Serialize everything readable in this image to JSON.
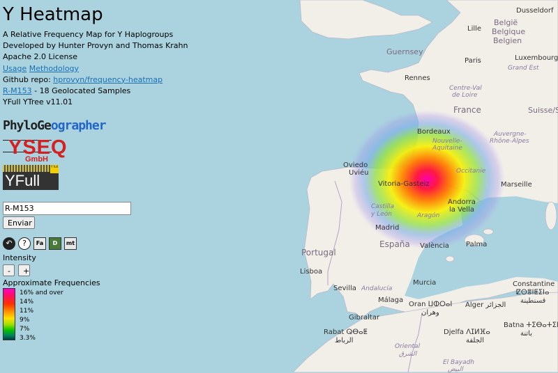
{
  "header": {
    "title": "Y Heatmap",
    "subtitle": "A Relative Frequency Map for Y Haplogroups",
    "developers": "Developed by Hunter Provyn and Thomas Krahn",
    "license": "Apache 2.0 License",
    "usage_link": "Usage",
    "methodology_link": "Methodology",
    "repo_prefix": "Github repo: ",
    "repo_link": "hprovyn/frequency-heatmap",
    "haplogroup_link": "R-M153",
    "samples_text": " - 18 Geolocated Samples",
    "tree_version": "YFull YTree v11.01"
  },
  "logos": {
    "phylo_part1": "PhyloGe",
    "phylo_part2": "o",
    "phylo_part3": "grapher",
    "yseq_main": "YSEQ",
    "yseq_sub": "GmbH",
    "yfull_text": "YFull",
    "yfull_badge": "Y full"
  },
  "search": {
    "value": "R-M153",
    "submit_label": "Enviar"
  },
  "tool_icons": [
    {
      "name": "back-icon",
      "glyph": "↶"
    },
    {
      "name": "help-icon",
      "glyph": "?"
    },
    {
      "name": "fa-icon",
      "glyph": "Fa"
    },
    {
      "name": "d-icon",
      "glyph": "D"
    },
    {
      "name": "mt-icon",
      "glyph": "mt"
    }
  ],
  "intensity": {
    "label": "Intensity",
    "decrease_label": "-",
    "increase_label": "+"
  },
  "legend": {
    "title": "Approximate Frequencies",
    "labels": [
      "16% and over",
      "14%",
      "11%",
      "9%",
      "7%",
      "3.3%"
    ],
    "colors": [
      "#ff00c8",
      "#ff1060",
      "#ff3000",
      "#ff9000",
      "#ffe000",
      "#00c000",
      "#004040"
    ]
  },
  "map": {
    "water_color": "#aad3df",
    "land_color": "#f2efe9",
    "labels": {
      "duesseldorf": "Dusseldorf",
      "lille": "Lille",
      "belgie": "België",
      "belgique": "Belgique",
      "belgien": "Belgien",
      "guernsey": "Guernsey",
      "luxembourg": "Luxembourg",
      "paris": "Paris",
      "grand_est": "Grand Est",
      "rennes": "Rennes",
      "centre_val1": "Centre-Val",
      "centre_val2": "de Loire",
      "france": "France",
      "suisse": "Suisse/S",
      "bordeaux": "Bordeaux",
      "nouvelle1": "Nouvelle-",
      "nouvelle2": "Aquitaine",
      "auvergne1": "Auvergne-",
      "auvergne2": "Rhône-Alpes",
      "oviedo": "Oviedo",
      "uvieu": "Uviéu",
      "vitoria": "Vitoria-Gasteiz",
      "occitanie": "Occitanie",
      "marseille": "Marseille",
      "andorra1": "Andorra",
      "andorra2": "la Vella",
      "castilla1": "Castilla",
      "castilla2": "y León",
      "madrid": "Madrid",
      "aragon": "Aragón",
      "espana": "España",
      "valencia": "València",
      "palma": "Palma",
      "portugal": "Portugal",
      "lisboa": "Lisboa",
      "sevilla": "Sevilla",
      "andalucia": "Andalucía",
      "murcia": "Murcia",
      "malaga": "Málaga",
      "gibraltar": "Gibraltar",
      "oran": "Oran ⵡⵀⵔⴰⵏ",
      "oran_ar": "وهران",
      "alger": "Alger الجزائر",
      "constantine": "Constantine",
      "constantine_tif": "ⵇⵙⴻⵏⵟⵉⵏⴰ",
      "constantine_ar": "قسنطينة",
      "rabat": "Rabat ⵕⴱⴰⵟ",
      "rabat_ar": "الرباط",
      "oriental": "Oriental",
      "oriental_ar": "الشرق",
      "djelfa": "Djelfa ⴷⵊⵍⴼⴰ",
      "djelfa_ar": "الجلفة",
      "batna": "Batna ⵜⵉⴱⴰⵜⵉⵏ",
      "batna_ar": "باتنة",
      "el_bayadh": "El Bayadh",
      "el_bayadh_ar": "البيض"
    }
  }
}
